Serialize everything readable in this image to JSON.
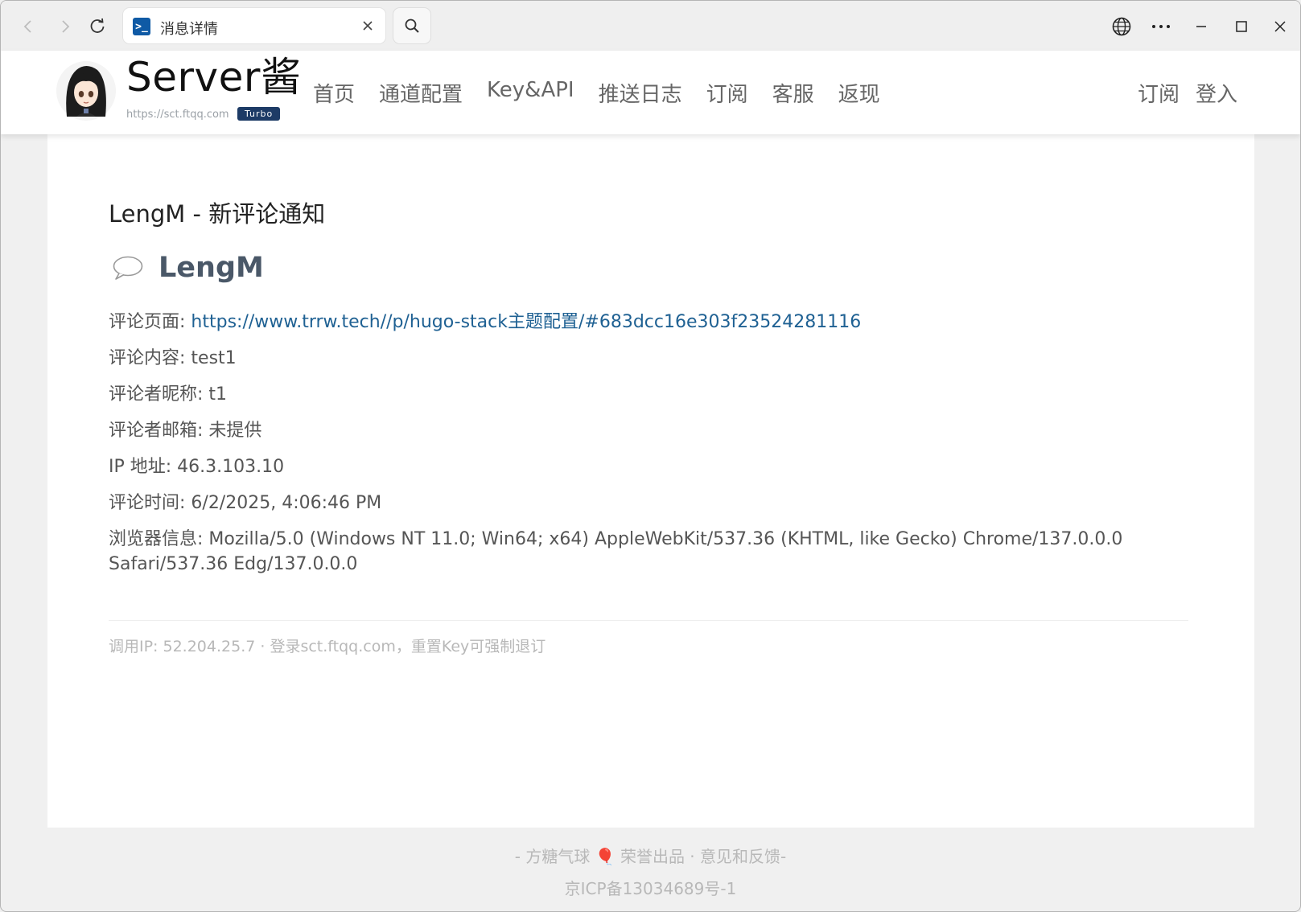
{
  "browser": {
    "tab_title": "消息详情",
    "tab_icon": ">_"
  },
  "site": {
    "logo_title": "Server酱",
    "logo_url": "https://sct.ftqq.com",
    "logo_badge": "Turbo",
    "nav": [
      "首页",
      "通道配置",
      "Key&API",
      "推送日志",
      "订阅",
      "客服",
      "返现"
    ],
    "nav_right": [
      "订阅",
      "登入"
    ]
  },
  "message": {
    "title": "LengM - 新评论通知",
    "author": "LengM",
    "fields": {
      "page_label": "评论页面: ",
      "page_link": "https://www.trrw.tech//p/hugo-stack主题配置/#683dcc16e303f23524281116",
      "content": "评论内容: test1",
      "nickname": "评论者昵称: t1",
      "email": "评论者邮箱: 未提供",
      "ip": "IP 地址: 46.3.103.10",
      "time": "评论时间: 6/2/2025, 4:06:46 PM",
      "browser": "浏览器信息: Mozilla/5.0 (Windows NT 11.0; Win64; x64) AppleWebKit/537.36 (KHTML, like Gecko) Chrome/137.0.0.0 Safari/537.36 Edg/137.0.0.0"
    },
    "footnote": "调用IP: 52.204.25.7 · 登录sct.ftqq.com，重置Key可强制退订"
  },
  "footer": {
    "prefix": "- 方糖气球 ",
    "balloon": "🎈",
    "suffix": " 荣誉出品 · 意见和反馈-",
    "icp": "京ICP备13034689号-1"
  },
  "colors": {
    "link": "#1f6193",
    "badge": "#1d3b66",
    "favicon": "#0f5aa5"
  }
}
